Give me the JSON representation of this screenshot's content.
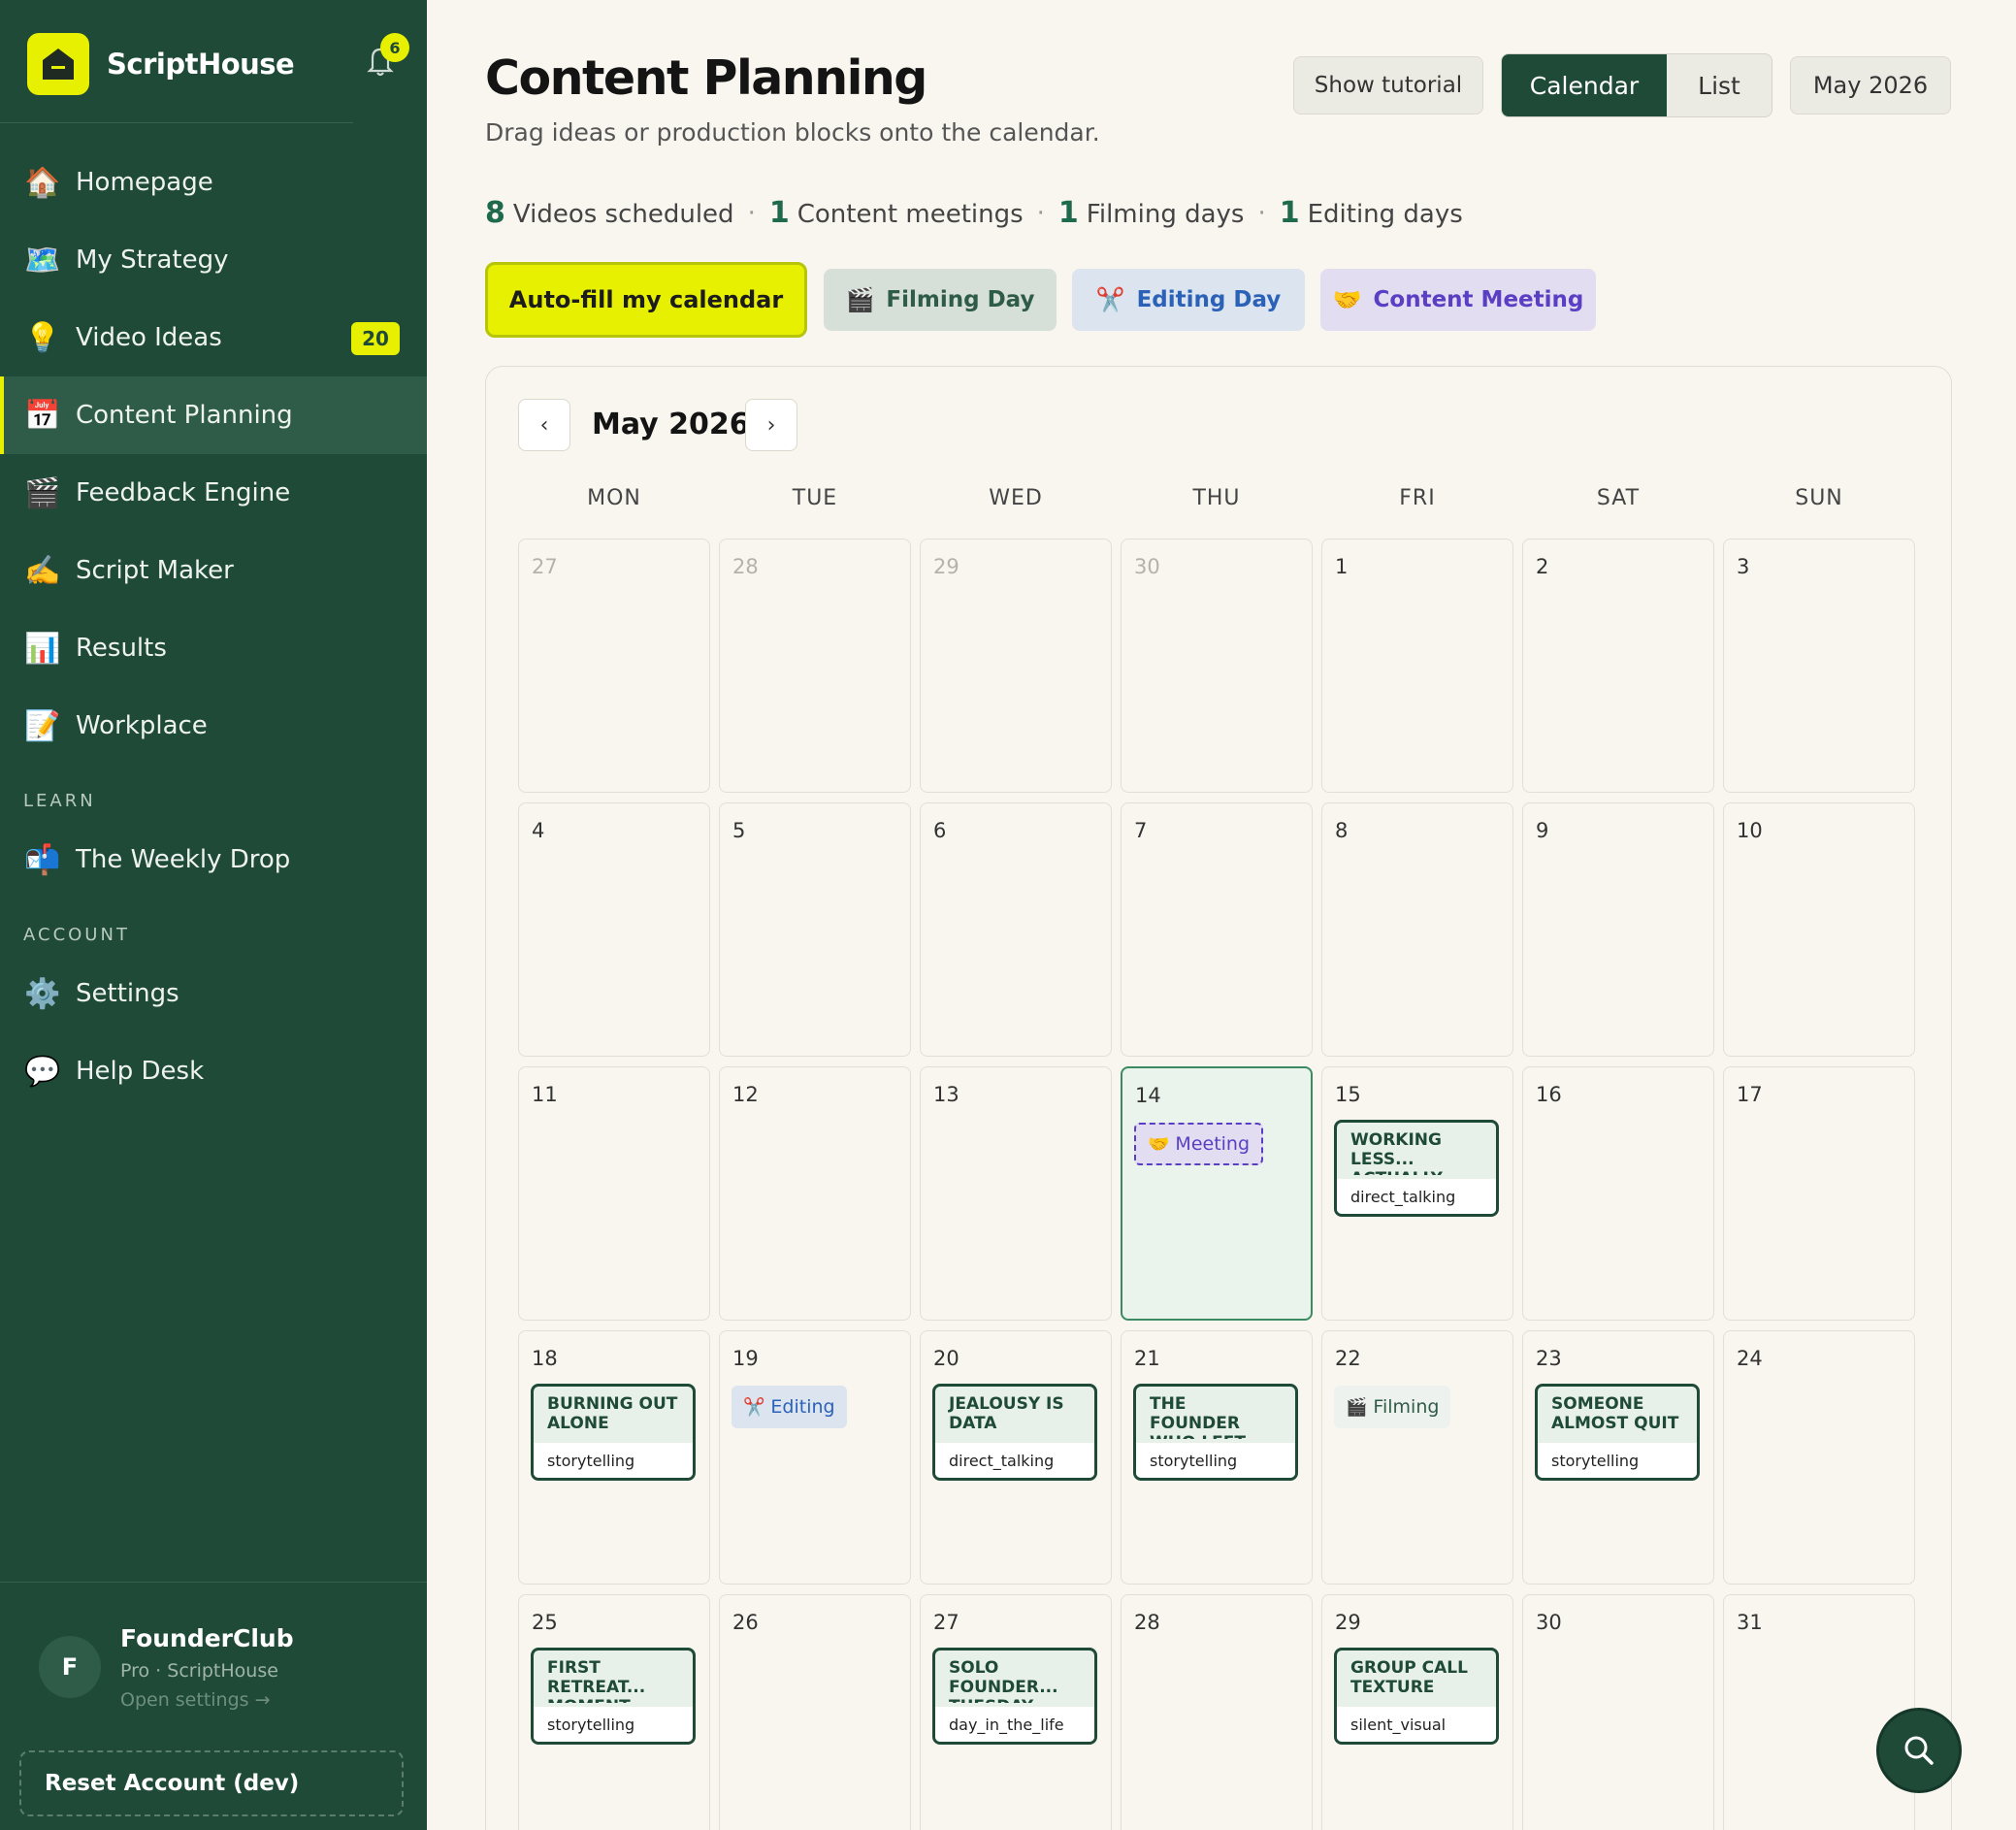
{
  "brand": {
    "name": "ScriptHouse",
    "notifications": "6"
  },
  "nav": [
    {
      "label": "Homepage",
      "icon": "🏠",
      "name": "sidebar-item-homepage"
    },
    {
      "label": "My Strategy",
      "icon": "🗺️",
      "name": "sidebar-item-my-strategy"
    },
    {
      "label": "Video Ideas",
      "icon": "💡",
      "name": "sidebar-item-video-ideas",
      "badge": "20"
    },
    {
      "label": "Content Planning",
      "icon": "📅",
      "name": "sidebar-item-content-planning",
      "active": true
    },
    {
      "label": "Feedback Engine",
      "icon": "🎬",
      "name": "sidebar-item-feedback-engine"
    },
    {
      "label": "Script Maker",
      "icon": "✍️",
      "name": "sidebar-item-script-maker"
    },
    {
      "label": "Results",
      "icon": "📊",
      "name": "sidebar-item-results"
    },
    {
      "label": "Workplace",
      "icon": "📝",
      "name": "sidebar-item-workplace"
    }
  ],
  "learn": {
    "label": "LEARN",
    "items": [
      {
        "label": "The Weekly Drop",
        "icon": "📬",
        "name": "sidebar-item-weekly-drop"
      }
    ]
  },
  "account": {
    "label": "ACCOUNT",
    "items": [
      {
        "label": "Settings",
        "icon": "⚙️",
        "name": "sidebar-item-settings"
      },
      {
        "label": "Help Desk",
        "icon": "💬",
        "name": "sidebar-item-help-desk"
      }
    ]
  },
  "user": {
    "initial": "F",
    "name": "FounderClub",
    "plan": "Pro · ScriptHouse",
    "link": "Open settings →"
  },
  "reset_label": "Reset Account (dev)",
  "page": {
    "title": "Content Planning",
    "subtitle": "Drag ideas or production blocks onto the calendar.",
    "show_tutorial": "Show tutorial",
    "view_calendar": "Calendar",
    "view_list": "List",
    "month_button": "May 2026"
  },
  "stats": [
    {
      "num": "8",
      "label": "Videos scheduled"
    },
    {
      "num": "1",
      "label": "Content meetings"
    },
    {
      "num": "1",
      "label": "Filming days"
    },
    {
      "num": "1",
      "label": "Editing days"
    }
  ],
  "actions": {
    "autofill": "Auto-fill my calendar",
    "filming": {
      "label": "Filming Day",
      "icon": "🎬"
    },
    "editing": {
      "label": "Editing Day",
      "icon": "✂️"
    },
    "meeting": {
      "label": "Content Meeting",
      "icon": "🤝"
    }
  },
  "calendar": {
    "title": "May 2026",
    "prev": "‹",
    "next": "›",
    "weekdays": [
      "MON",
      "TUE",
      "WED",
      "THU",
      "FRI",
      "SAT",
      "SUN"
    ],
    "days": [
      {
        "n": "27",
        "out": true
      },
      {
        "n": "28",
        "out": true
      },
      {
        "n": "29",
        "out": true
      },
      {
        "n": "30",
        "out": true
      },
      {
        "n": "1"
      },
      {
        "n": "2"
      },
      {
        "n": "3"
      },
      {
        "n": "4"
      },
      {
        "n": "5"
      },
      {
        "n": "6"
      },
      {
        "n": "7"
      },
      {
        "n": "8"
      },
      {
        "n": "9"
      },
      {
        "n": "10"
      },
      {
        "n": "11"
      },
      {
        "n": "12"
      },
      {
        "n": "13"
      },
      {
        "n": "14",
        "today": true,
        "pill": {
          "type": "meet",
          "icon": "🤝",
          "label": "Meeting"
        }
      },
      {
        "n": "15",
        "card": {
          "title": "Working less... actually",
          "tag": "direct_talking"
        }
      },
      {
        "n": "16"
      },
      {
        "n": "17"
      },
      {
        "n": "18",
        "card": {
          "title": "Burning out alone",
          "tag": "storytelling"
        }
      },
      {
        "n": "19",
        "pill": {
          "type": "edit",
          "icon": "✂️",
          "label": "Editing"
        }
      },
      {
        "n": "20",
        "card": {
          "title": "Jealousy is data",
          "tag": "direct_talking"
        }
      },
      {
        "n": "21",
        "card": {
          "title": "The founder who left",
          "tag": "storytelling"
        }
      },
      {
        "n": "22",
        "pill": {
          "type": "film",
          "icon": "🎬",
          "label": "Filming"
        }
      },
      {
        "n": "23",
        "card": {
          "title": "Someone almost quit",
          "tag": "storytelling"
        }
      },
      {
        "n": "24"
      },
      {
        "n": "25",
        "card": {
          "title": "First retreat... moment",
          "tag": "storytelling"
        }
      },
      {
        "n": "26"
      },
      {
        "n": "27",
        "card": {
          "title": "Solo founder... Tuesday",
          "tag": "day_in_the_life"
        }
      },
      {
        "n": "28"
      },
      {
        "n": "29",
        "card": {
          "title": "Group call texture",
          "tag": "silent_visual"
        }
      },
      {
        "n": "30"
      },
      {
        "n": "31"
      }
    ]
  },
  "colors": {
    "sidebar": "#1f4a38",
    "accent": "#e6f000",
    "meeting": "#5a3ec4",
    "editing": "#2b62b8"
  }
}
